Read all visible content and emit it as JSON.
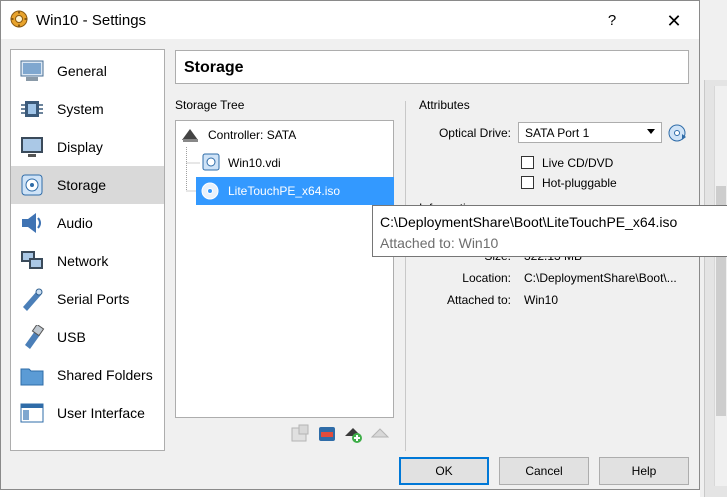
{
  "window": {
    "title": "Win10 - Settings",
    "help_label": "?",
    "close_label": "✕"
  },
  "sidebar": {
    "items": [
      {
        "label": "General",
        "icon": "general-icon"
      },
      {
        "label": "System",
        "icon": "system-icon"
      },
      {
        "label": "Display",
        "icon": "display-icon"
      },
      {
        "label": "Storage",
        "icon": "storage-icon",
        "selected": true
      },
      {
        "label": "Audio",
        "icon": "audio-icon"
      },
      {
        "label": "Network",
        "icon": "network-icon"
      },
      {
        "label": "Serial Ports",
        "icon": "serial-ports-icon"
      },
      {
        "label": "USB",
        "icon": "usb-icon"
      },
      {
        "label": "Shared Folders",
        "icon": "shared-folders-icon"
      },
      {
        "label": "User Interface",
        "icon": "user-interface-icon"
      }
    ]
  },
  "main": {
    "header": "Storage",
    "storage_tree": {
      "title": "Storage Tree",
      "controller": "Controller: SATA",
      "items": [
        {
          "label": "Win10.vdi",
          "icon": "hard-disk-icon"
        },
        {
          "label": "LiteTouchPE_x64.iso",
          "icon": "optical-disc-icon",
          "selected": true
        }
      ]
    },
    "attributes": {
      "title": "Attributes",
      "optical_drive_label": "Optical Drive:",
      "optical_drive_value": "SATA Port 1",
      "live_cd_label": "Live CD/DVD",
      "hot_pluggable_label": "Hot-pluggable"
    },
    "information": {
      "title": "Information",
      "size_label": "Size:",
      "size_value": "322.13 MB",
      "location_label": "Location:",
      "location_value": "C:\\DeploymentShare\\Boot\\...",
      "attached_label": "Attached to:",
      "attached_value": "Win10"
    },
    "tooltip": {
      "path": "C:\\DeploymentShare\\Boot\\LiteTouchPE_x64.iso",
      "attached": "Attached to: Win10"
    }
  },
  "buttons": {
    "ok": "OK",
    "cancel": "Cancel",
    "help": "Help"
  },
  "colors": {
    "selection": "#3399ff",
    "accent": "#0078d7"
  }
}
